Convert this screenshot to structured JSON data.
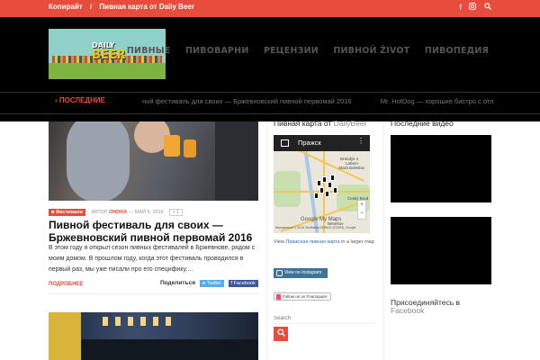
{
  "topbar": {
    "links": [
      "Копирайт",
      "/",
      "Пивная карта от Daily Beer"
    ],
    "icons": [
      "facebook-icon",
      "instagram-icon",
      "search-icon"
    ]
  },
  "logo": {
    "line1": "DAILY",
    "line2": "BEER"
  },
  "nav": {
    "items": [
      "ПИВНЫЕ",
      "ПИВОВАРНИ",
      "РЕЦЕНЗИИ",
      "ПИВНОЙ ŽIVOT",
      "ПИВОПЕДИЯ"
    ]
  },
  "ticker": {
    "label": "ПОСЛЕДНИЕ",
    "items": [
      "ной фестиваль для своих — Бржевновский пивной первомай 2016",
      "Mr. HotDog — хорошие бистро с отличн"
    ]
  },
  "post": {
    "tag": "Фестивали",
    "author_prefix": "АВТОР",
    "author": "ONDRA",
    "date": "МАЙ 5, 2016",
    "comments": "1",
    "title": "Пивной фестиваль для своих — Бржевновский пивной первомай 2016",
    "excerpt": "В этом году я открыл сезон пивных фестивалей в Бржевнове, рядом с моим домом. В прошлом году, когда этот фестиваль проводился в первый раз, мы уже писали про его специфику.…",
    "more": "ПОДРОБНЕЕ",
    "share_label": "Поделиться",
    "share_twitter": "Twitter",
    "share_facebook": "Facebook"
  },
  "beer_map": {
    "title": "Пивная карта от",
    "title_brand": "DailyBeer",
    "bar_title": "Пражск",
    "city_labels": [
      "Brandýs n.",
      "Labem-",
      "Stará Boleslav",
      "Český Brod",
      "Benešov"
    ],
    "google": "Google",
    "my_maps": "My Maps",
    "copyright": "Картданные © 2016 GeoBasis-DE/BKG (©2009), Google",
    "caption_before": "View",
    "caption_link": "Пражская пивная карта",
    "caption_after": "in a larger map",
    "zoom_in": "+",
    "zoom_out": "−"
  },
  "instagram_button": "View on Instagram",
  "foursquare_button": "Follow us on Foursquare",
  "search": {
    "placeholder": "Search"
  },
  "sidebar": {
    "videos_title": "Последние видео",
    "join_title": "Присоединяйтесь в",
    "join_sub": "Facebook"
  },
  "colors": {
    "accent": "#e74c3c",
    "header_bg": "#000000",
    "twitter": "#55acee",
    "facebook": "#3b5998",
    "instagram": "#3f729b"
  }
}
